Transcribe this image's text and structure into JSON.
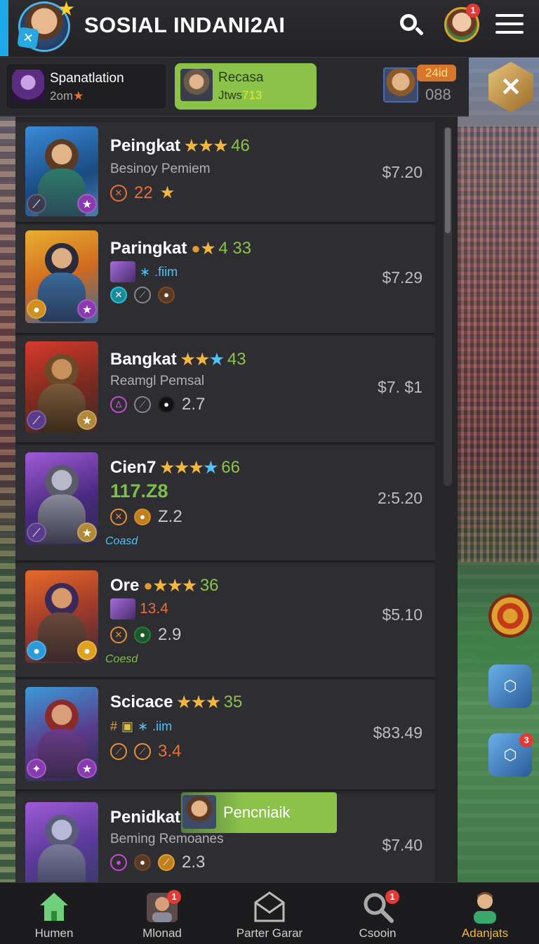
{
  "header": {
    "title": "SOSIAL INDANI2AI",
    "profile_notifications": "1"
  },
  "subbar": {
    "tab1": {
      "title": "Spanatlation",
      "meta": "2om"
    },
    "tab2": {
      "title": "Recasa",
      "meta_prefix": "Jtws",
      "meta_value": "713"
    },
    "right_tag": "24id",
    "right_value": "088"
  },
  "cards": [
    {
      "name": "Peingkat",
      "rating": "46",
      "sub": "Besinoy Pemiem",
      "stat1": "22",
      "price": "$7.20"
    },
    {
      "name": "Paringkat",
      "rating": "4 33",
      "sub": ".fiim",
      "price": "$7.29"
    },
    {
      "name": "Bangkat",
      "rating": "43",
      "sub": "Reamgl Pemsal",
      "stat1": "2.7",
      "price": "$7. $1"
    },
    {
      "name": "Cien7",
      "rating": "66",
      "sub": "117.Z8",
      "stat1": "Z.2",
      "tag": "Coasd",
      "price": "2:5.20"
    },
    {
      "name": "Ore",
      "rating": "36",
      "sub": "13.4",
      "stat1": "2.9",
      "tag": "Coesd",
      "price": "$5.10"
    },
    {
      "name": "Scicace",
      "rating": "35",
      "sub": ".iim",
      "stat1": "3.4",
      "price": "$83.49"
    },
    {
      "name": "Penidkat",
      "sub": "Beming Remoanes",
      "stat1": "2.3",
      "price": "$7.40"
    }
  ],
  "toast": {
    "text": "Pencniaik"
  },
  "fabs": {
    "cube2_badge": "3"
  },
  "nav": [
    {
      "label": "Humen",
      "icon": "home-icon"
    },
    {
      "label": "Mlonad",
      "icon": "avatar-icon",
      "badge": "1"
    },
    {
      "label": "Parter Garar",
      "icon": "mail-icon"
    },
    {
      "label": "Csooin",
      "icon": "search-icon",
      "badge": "1"
    },
    {
      "label": "Adanjats",
      "icon": "profile-icon"
    }
  ],
  "colors": {
    "accent_blue": "#1ea9e8",
    "accent_green": "#8bc34a",
    "star_gold": "#f4b73a",
    "rating_green": "#8bc34a",
    "badge_red": "#e53935"
  }
}
